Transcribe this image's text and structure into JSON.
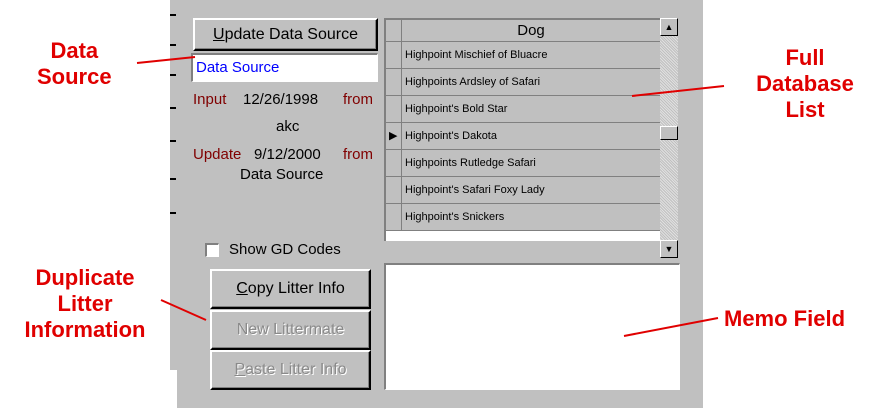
{
  "toolbar": {
    "update_button": "Update Data Source"
  },
  "data_source_field": {
    "value": "Data Source"
  },
  "info": {
    "input_label": "Input",
    "input_date": "12/26/1998",
    "input_from": "from",
    "input_source": "akc",
    "update_label": "Update",
    "update_date": "9/12/2000",
    "update_from": "from",
    "update_source": "Data Source"
  },
  "checkbox": {
    "label": "Show GD Codes",
    "checked": false
  },
  "buttons": {
    "copy": "Copy Litter Info",
    "new": "New Littermate",
    "paste": "Paste Litter Info"
  },
  "grid": {
    "header": "Dog",
    "rows": [
      "Highpoint Mischief of Bluacre",
      "Highpoints Ardsley of Safari",
      "Highpoint's Bold Star",
      "Highpoint's Dakota",
      "Highpoints Rutledge Safari",
      "Highpoint's Safari Foxy Lady",
      "Highpoint's Snickers"
    ],
    "current_row_index": 3
  },
  "annotations": {
    "data_source": "Data\nSource",
    "full_db": "Full\nDatabase\nList",
    "duplicate": "Duplicate\nLitter\nInformation",
    "memo": "Memo Field"
  },
  "colors": {
    "annotation": "#e00000",
    "panel": "#c0c0c0",
    "dark_label": "#800000",
    "link_blue": "#0000ff"
  },
  "icons": {
    "scroll_up": "triangle-up",
    "scroll_down": "triangle-down",
    "row_pointer": "triangle-right"
  }
}
